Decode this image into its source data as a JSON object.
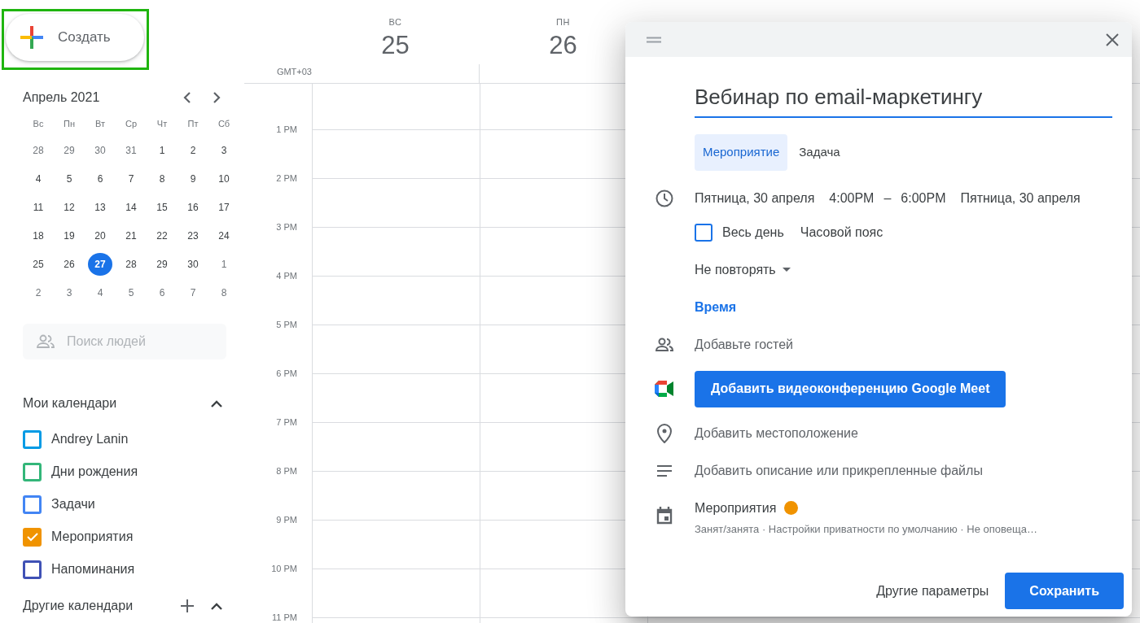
{
  "create_button": {
    "label": "Создать"
  },
  "mini_calendar": {
    "title": "Апрель 2021",
    "weekdays": [
      "Вс",
      "Пн",
      "Вт",
      "Ср",
      "Чт",
      "Пт",
      "Сб"
    ],
    "weeks": [
      [
        {
          "label": "28",
          "muted": true,
          "selected": false
        },
        {
          "label": "29",
          "muted": true,
          "selected": false
        },
        {
          "label": "30",
          "muted": true,
          "selected": false
        },
        {
          "label": "31",
          "muted": true,
          "selected": false
        },
        {
          "label": "1",
          "muted": false,
          "selected": false
        },
        {
          "label": "2",
          "muted": false,
          "selected": false
        },
        {
          "label": "3",
          "muted": false,
          "selected": false
        }
      ],
      [
        {
          "label": "4",
          "muted": false,
          "selected": false
        },
        {
          "label": "5",
          "muted": false,
          "selected": false
        },
        {
          "label": "6",
          "muted": false,
          "selected": false
        },
        {
          "label": "7",
          "muted": false,
          "selected": false
        },
        {
          "label": "8",
          "muted": false,
          "selected": false
        },
        {
          "label": "9",
          "muted": false,
          "selected": false
        },
        {
          "label": "10",
          "muted": false,
          "selected": false
        }
      ],
      [
        {
          "label": "11",
          "muted": false,
          "selected": false
        },
        {
          "label": "12",
          "muted": false,
          "selected": false
        },
        {
          "label": "13",
          "muted": false,
          "selected": false
        },
        {
          "label": "14",
          "muted": false,
          "selected": false
        },
        {
          "label": "15",
          "muted": false,
          "selected": false
        },
        {
          "label": "16",
          "muted": false,
          "selected": false
        },
        {
          "label": "17",
          "muted": false,
          "selected": false
        }
      ],
      [
        {
          "label": "18",
          "muted": false,
          "selected": false
        },
        {
          "label": "19",
          "muted": false,
          "selected": false
        },
        {
          "label": "20",
          "muted": false,
          "selected": false
        },
        {
          "label": "21",
          "muted": false,
          "selected": false
        },
        {
          "label": "22",
          "muted": false,
          "selected": false
        },
        {
          "label": "23",
          "muted": false,
          "selected": false
        },
        {
          "label": "24",
          "muted": false,
          "selected": false
        }
      ],
      [
        {
          "label": "25",
          "muted": false,
          "selected": false
        },
        {
          "label": "26",
          "muted": false,
          "selected": false
        },
        {
          "label": "27",
          "muted": false,
          "selected": true
        },
        {
          "label": "28",
          "muted": false,
          "selected": false
        },
        {
          "label": "29",
          "muted": false,
          "selected": false
        },
        {
          "label": "30",
          "muted": false,
          "selected": false
        },
        {
          "label": "1",
          "muted": true,
          "selected": false
        }
      ],
      [
        {
          "label": "2",
          "muted": true,
          "selected": false
        },
        {
          "label": "3",
          "muted": true,
          "selected": false
        },
        {
          "label": "4",
          "muted": true,
          "selected": false
        },
        {
          "label": "5",
          "muted": true,
          "selected": false
        },
        {
          "label": "6",
          "muted": true,
          "selected": false
        },
        {
          "label": "7",
          "muted": true,
          "selected": false
        },
        {
          "label": "8",
          "muted": true,
          "selected": false
        }
      ]
    ]
  },
  "people_search": {
    "placeholder": "Поиск людей"
  },
  "my_calendars": {
    "title": "Мои календари",
    "expanded": true,
    "items": [
      {
        "label": "Andrey Lanin",
        "color": "#039be5",
        "checked": false
      },
      {
        "label": "Дни рождения",
        "color": "#33b679",
        "checked": false
      },
      {
        "label": "Задачи",
        "color": "#4285f4",
        "checked": false
      },
      {
        "label": "Мероприятия",
        "color": "#f09300",
        "checked": true
      },
      {
        "label": "Напоминания",
        "color": "#3f51b5",
        "checked": false
      }
    ]
  },
  "other_calendars": {
    "title": "Другие календари",
    "expanded": true
  },
  "day_view": {
    "timezone": "GMT+03",
    "days": [
      {
        "weekday": "ВС",
        "date": "25"
      },
      {
        "weekday": "ПН",
        "date": "26"
      }
    ],
    "hours": [
      "1 PM",
      "2 PM",
      "3 PM",
      "4 PM",
      "5 PM",
      "6 PM",
      "7 PM",
      "8 PM",
      "9 PM",
      "10 PM",
      "11 PM"
    ]
  },
  "event_dialog": {
    "title": "Вебинар по email-маркетингу",
    "tabs": [
      {
        "label": "Мероприятие",
        "selected": true
      },
      {
        "label": "Задача",
        "selected": false
      }
    ],
    "start_date": "Пятница, 30 апреля",
    "start_time": "4:00PM",
    "dash": "–",
    "end_time": "6:00PM",
    "end_date": "Пятница, 30 апреля",
    "all_day": {
      "label": "Весь день",
      "checked": false
    },
    "timezone_link": "Часовой пояс",
    "repeat": "Не повторять",
    "time_link": "Время",
    "guests_placeholder": "Добавьте гостей",
    "meet_button": "Добавить видеоконференцию Google Meet",
    "location_placeholder": "Добавить местоположение",
    "description_placeholder": "Добавить описание или прикрепленные файлы",
    "calendar": {
      "name": "Мероприятия",
      "color": "#f09300"
    },
    "calendar_details": "Занят/занята · Настройки приватности по умолчанию · Не оповеща…",
    "more_options": "Другие параметры",
    "save": "Сохранить"
  }
}
